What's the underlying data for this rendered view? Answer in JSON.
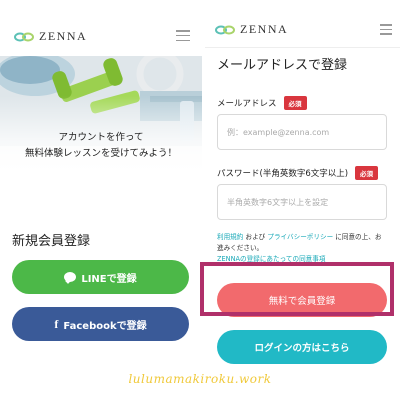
{
  "left": {
    "logo_text": "ZENNA",
    "hero_line1": "アカウントを作って",
    "hero_line2": "無料体験レッスンを受けてみよう！",
    "signup_title": "新規会員登録",
    "line_button": "LINEで登録",
    "facebook_button": "Facebookで登録"
  },
  "right": {
    "logo_text": "ZENNA",
    "title": "メールアドレスで登録",
    "email_label": "メールアドレス",
    "email_required": "必須",
    "email_placeholder": "例：example@zenna.com",
    "password_label": "パスワード(半角英数字6文字以上)",
    "password_required": "必須",
    "password_placeholder": "半角英数字6文字以上を設定",
    "terms_link1": "利用規約",
    "terms_and": " および ",
    "terms_link2": "プライバシーポリシー",
    "terms_text": " に同意の上、お進みください。",
    "terms_link3": "ZENNAの登録にあたっての同意事項",
    "free_button": "無料で会員登録",
    "login_button": "ログインの方はこちら"
  },
  "watermark": "lulumamakiroku.work",
  "colors": {
    "line_green": "#4cb848",
    "facebook_blue": "#3a5a98",
    "coral": "#f26a6d",
    "teal": "#21b9c6",
    "required_red": "#d9363e",
    "highlight_border": "#b0306a"
  }
}
